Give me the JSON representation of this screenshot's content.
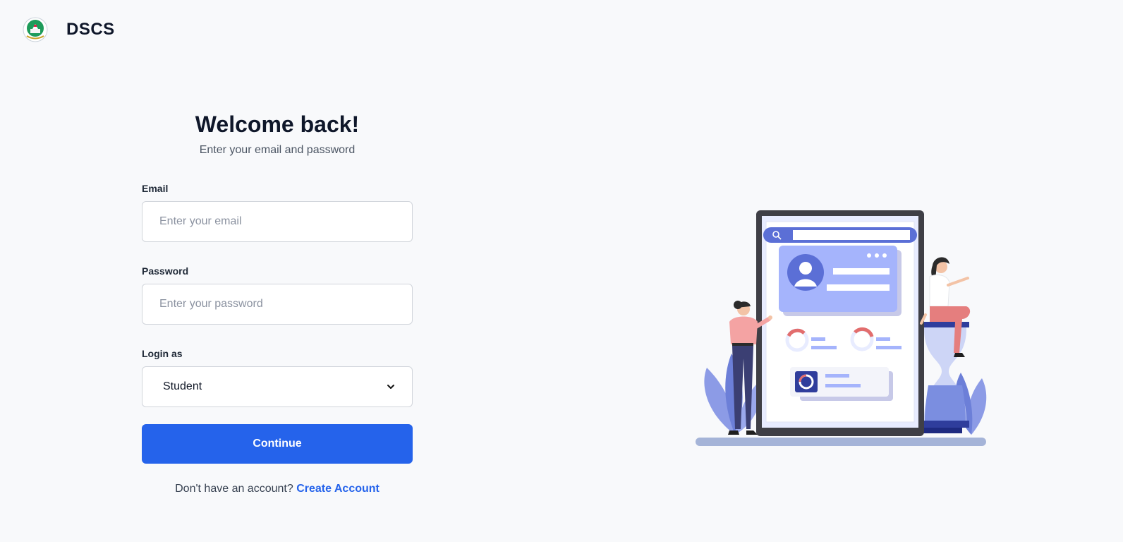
{
  "header": {
    "brand": "DSCS",
    "logo_icon": "university-seal-icon"
  },
  "form": {
    "title": "Welcome back!",
    "subtitle": "Enter your email and password",
    "email": {
      "label": "Email",
      "placeholder": "Enter your email",
      "value": ""
    },
    "password": {
      "label": "Password",
      "placeholder": "Enter your password",
      "value": ""
    },
    "role": {
      "label": "Login as",
      "selected": "Student",
      "icon": "chevron-down-icon"
    },
    "continue_label": "Continue",
    "signup_prompt": "Don't have an account?",
    "signup_link": "Create Account"
  },
  "colors": {
    "primary": "#2563eb",
    "background": "#f8f9fb",
    "illustration_accent": "#7b8ee0"
  }
}
